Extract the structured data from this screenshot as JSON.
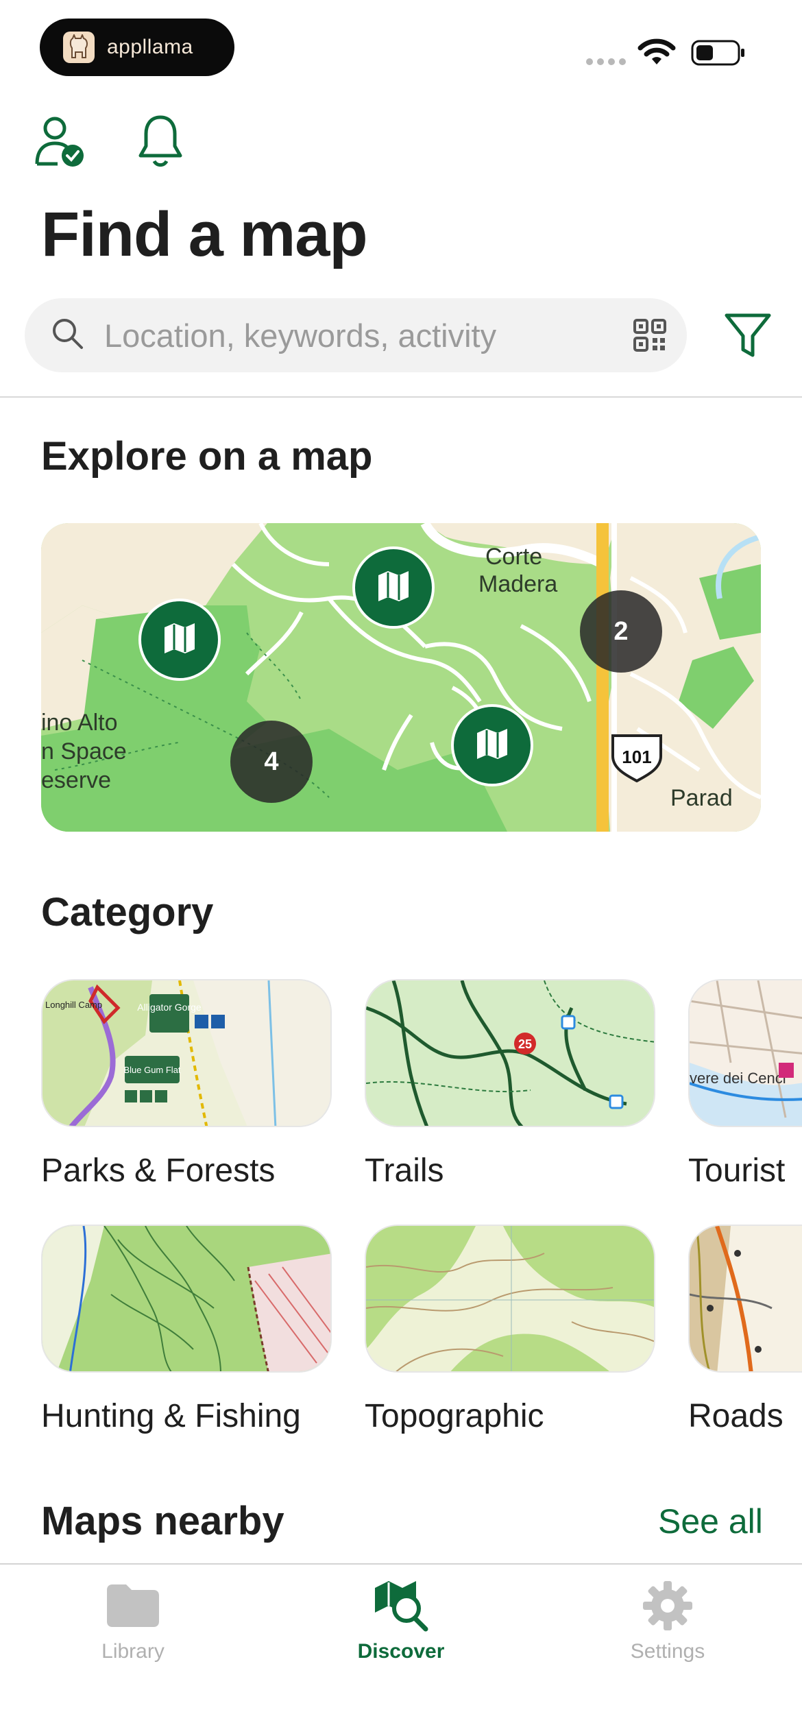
{
  "status_bar": {
    "app_name": "appllama"
  },
  "header": {
    "title": "Find a map"
  },
  "search": {
    "placeholder": "Location, keywords, activity"
  },
  "explore": {
    "title": "Explore on a map",
    "place_labels": [
      "Corte",
      "Madera",
      "ino Alto",
      "n Space",
      "eserve",
      "Parad"
    ],
    "route_shield": "101",
    "clusters": [
      "2",
      "4"
    ]
  },
  "category": {
    "title": "Category",
    "items": [
      {
        "label": "Parks & Forests",
        "thumb": "parks"
      },
      {
        "label": "Trails",
        "thumb": "trails"
      },
      {
        "label": "Tourist",
        "thumb": "tourist"
      },
      {
        "label": "Hunting & Fishing",
        "thumb": "hunting"
      },
      {
        "label": "Topographic",
        "thumb": "topo"
      },
      {
        "label": "Roads",
        "thumb": "roads"
      }
    ],
    "thumb_text": {
      "parks_1": "Alligator Gorge",
      "parks_2": "Blue Gum Flat",
      "parks_3": "Longhill Camp",
      "trails_1": "25",
      "tourist_1": "vere dei Cenci"
    }
  },
  "nearby": {
    "title": "Maps nearby",
    "see_all": "See all"
  },
  "tab_bar": {
    "items": [
      {
        "label": "Library",
        "icon": "folder-icon"
      },
      {
        "label": "Discover",
        "icon": "map-search-icon"
      },
      {
        "label": "Settings",
        "icon": "gear-icon"
      }
    ]
  },
  "colors": {
    "brand_green": "#0e6b3b",
    "map_green": "#7fcf6e",
    "map_light_green": "#a9dc87",
    "road_yellow": "#f5c33b"
  }
}
